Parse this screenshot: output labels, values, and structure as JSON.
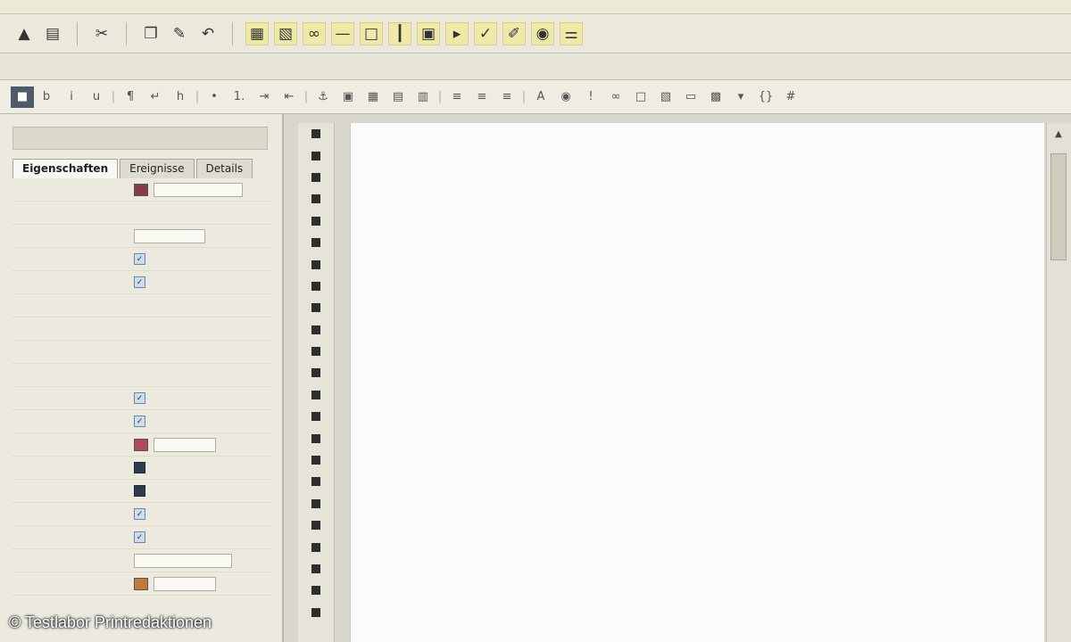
{
  "panel": {
    "tabs": [
      {
        "label": "Eigenschaften"
      },
      {
        "label": "Ereignisse"
      },
      {
        "label": "Details"
      }
    ]
  },
  "watermark": {
    "text": "© Testlabor Printredaktionen"
  },
  "toolbar": {
    "icons": [
      "open-icon",
      "save-icon",
      "cut-icon",
      "copy-icon",
      "paste-icon",
      "table-icon",
      "form-icon",
      "link-icon",
      "image-icon",
      "color-icon",
      "tag-icon"
    ]
  },
  "colors": {
    "editor_bg": "#fbfbf9",
    "panel_bg": "#ece9df",
    "highlight": "#f0eaa8"
  }
}
